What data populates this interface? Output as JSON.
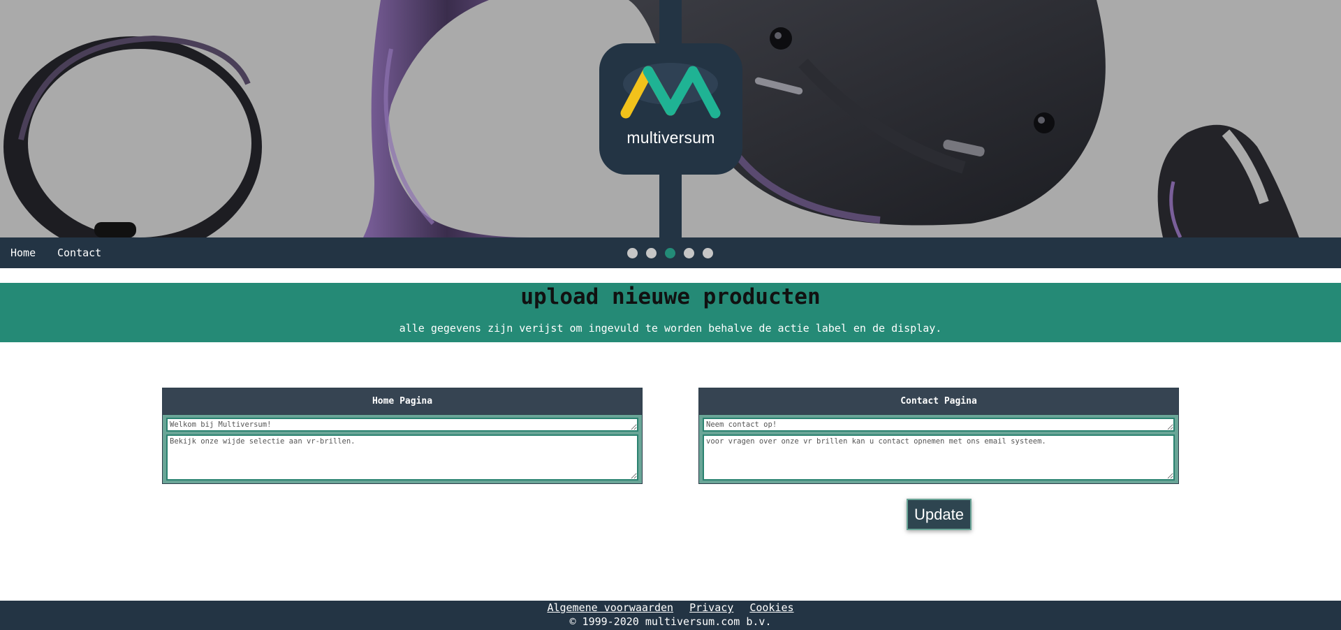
{
  "hero": {
    "logo_text": "multiversum",
    "colors": {
      "badge": "#233444",
      "yellow": "#f2c21b",
      "teal": "#1fb394"
    }
  },
  "nav": {
    "links": [
      "Home",
      "Contact"
    ],
    "carousel": {
      "slides": 5,
      "active_index": 2
    }
  },
  "banner": {
    "title": "upload nieuwe producten",
    "subtitle": "alle gegevens zijn verijst om ingevuld te worden behalve de actie label en de display."
  },
  "home_panel": {
    "header": "Home Pagina",
    "title_value": "Welkom bij Multiversum!",
    "body_value": "Bekijk onze wijde selectie aan vr-brillen."
  },
  "contact_panel": {
    "header": "Contact Pagina",
    "title_value": "Neem contact op!",
    "body_value": "voor vragen over onze vr brillen kan u contact opnemen met ons email systeem."
  },
  "update_button": "Update",
  "footer": {
    "links": [
      "Algemene voorwaarden",
      "Privacy",
      "Cookies"
    ],
    "copyright": "© 1999-2020 multiversum.com b.v."
  }
}
